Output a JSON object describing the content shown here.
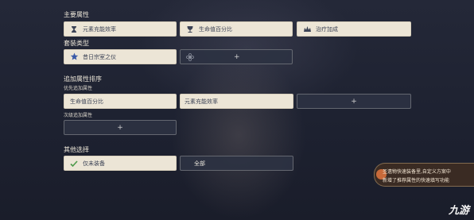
{
  "main_stats": {
    "label": "主要属性",
    "options": [
      "元素充能效率",
      "生命值百分比",
      "治疗加成"
    ]
  },
  "set_type": {
    "label": "套装类型",
    "selected": "昔日宗室之仪",
    "add_symbol": "+"
  },
  "sub_stat_order": {
    "label": "追加属性排序",
    "priority_label": "优先追加属性",
    "priority": [
      "生命值百分比",
      "元素充能效率"
    ],
    "secondary_label": "次级追加属性",
    "add_symbol": "+"
  },
  "other": {
    "label": "其他选择",
    "options": [
      "仅未装备",
      "全部"
    ]
  },
  "notice": {
    "line1": "圣遗物快速装备里,自定义方案中",
    "line2": "新增了推荐属性的快速填写功能"
  },
  "watermark": "九游",
  "icons": {
    "main1": "sand-icon",
    "main2": "goblet-icon",
    "main3": "circlet-icon",
    "set": "star-emblem-icon",
    "set_empty": "flower-icon",
    "check": "check-icon"
  }
}
